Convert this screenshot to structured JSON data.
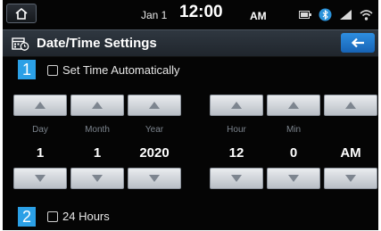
{
  "status_bar": {
    "date": "Jan 1",
    "time": "12:00",
    "ampm": "AM",
    "icons": [
      "battery-icon",
      "bluetooth-icon",
      "signal-icon",
      "wifi-icon"
    ]
  },
  "header": {
    "title": "Date/Time Settings",
    "back_icon": "back-arrow-icon"
  },
  "auto_time": {
    "number": "1",
    "label": "Set Time Automatically",
    "checked": false
  },
  "columns": [
    {
      "label": "Day",
      "value": "1"
    },
    {
      "label": "Month",
      "value": "1"
    },
    {
      "label": "Year",
      "value": "2020"
    },
    {
      "label": "Hour",
      "value": "12"
    },
    {
      "label": "Min",
      "value": "0"
    },
    {
      "label": "",
      "value": "AM"
    }
  ],
  "hours24": {
    "number": "2",
    "label": "24 Hours",
    "checked": false
  },
  "colors": {
    "accent": "#2ba0e6",
    "background": "#050505",
    "title_bar": "#262d35",
    "spinner": "#d6dade"
  }
}
